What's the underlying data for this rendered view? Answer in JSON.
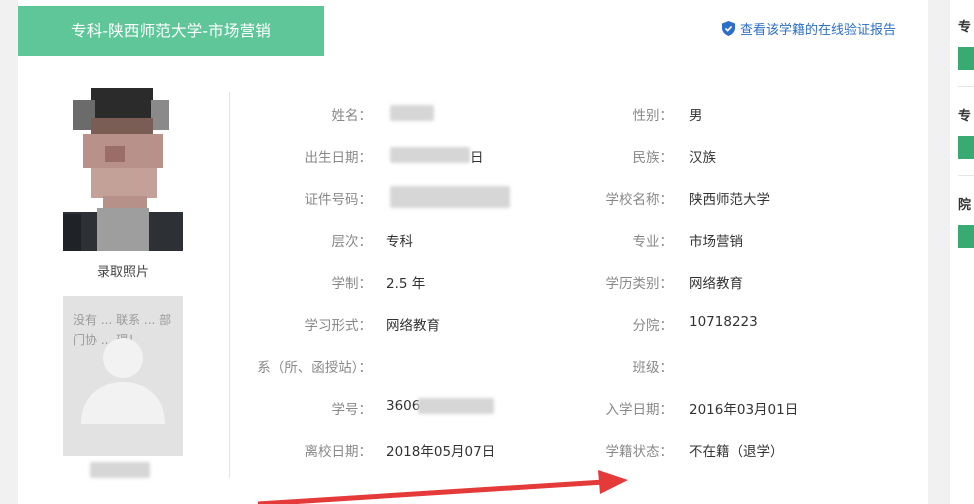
{
  "header": {
    "title": "专科-陕西师范大学-市场营销",
    "verify_link": "查看该学籍的在线验证报告"
  },
  "photos": {
    "admission_caption": "录取照片",
    "placeholder_text": "没有 ... 联系 ... 部门协 ... 理！"
  },
  "info": {
    "name_label": "姓名：",
    "name_value": "",
    "gender_label": "性别：",
    "gender_value": "男",
    "birth_label": "出生日期：",
    "birth_value": "日",
    "ethnicity_label": "民族：",
    "ethnicity_value": "汉族",
    "id_label": "证件号码：",
    "id_value": "",
    "school_label": "学校名称：",
    "school_value": "陕西师范大学",
    "level_label": "层次：",
    "level_value": "专科",
    "major_label": "专业：",
    "major_value": "市场营销",
    "duration_label": "学制：",
    "duration_value": "2.5 年",
    "edu_type_label": "学历类别：",
    "edu_type_value": "网络教育",
    "form_label": "学习形式：",
    "form_value": "网络教育",
    "branch_label": "分院：",
    "branch_value": "10718223",
    "dept_label": "系（所、函授站）：",
    "dept_value": "",
    "class_label": "班级：",
    "class_value": "",
    "student_no_label": "学号：",
    "student_no_value": "3606",
    "enroll_label": "入学日期：",
    "enroll_value": "2016年03月01日",
    "leave_label": "离校日期：",
    "leave_value": "2018年05月07日",
    "status_label": "学籍状态：",
    "status_value": "不在籍（退学）"
  },
  "sidebar": {
    "items": [
      {
        "label": "专"
      },
      {
        "label": "专"
      },
      {
        "label": "院"
      }
    ],
    "button_color": "#3aaa73"
  },
  "colors": {
    "accent_green": "#5fc69a",
    "link_blue": "#2c6fc4",
    "annotation_arrow": "#e43a3a"
  }
}
